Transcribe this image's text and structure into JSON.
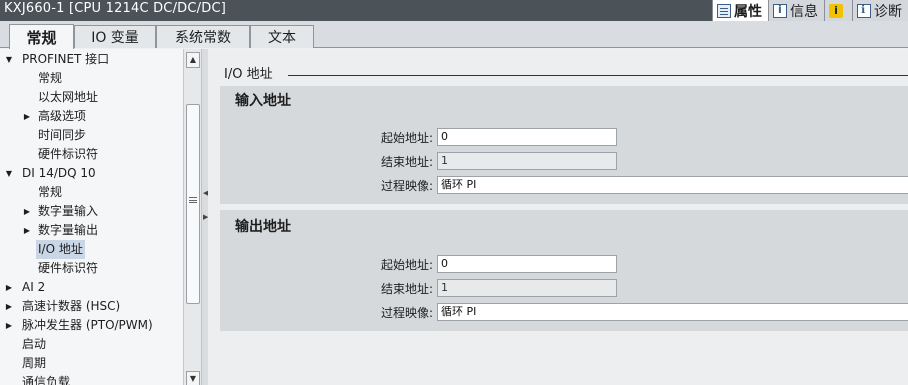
{
  "window": {
    "title": "KXJ660-1 [CPU 1214C DC/DC/DC]"
  },
  "inspector_tabs": [
    {
      "label": "属性",
      "icon": "properties-icon",
      "active": true
    },
    {
      "label": "信息",
      "icon": "info-icon",
      "active": false
    },
    {
      "label": "",
      "icon": "warning-icon",
      "active": false
    },
    {
      "label": "诊断",
      "icon": "diagnostics-icon",
      "active": false
    }
  ],
  "tabs": [
    {
      "label": "常规",
      "active": true
    },
    {
      "label": "IO 变量",
      "active": false
    },
    {
      "label": "系统常数",
      "active": false
    },
    {
      "label": "文本",
      "active": false
    }
  ],
  "tree": [
    {
      "label": "PROFINET 接口",
      "level": 0,
      "arrow": "expanded"
    },
    {
      "label": "常规",
      "level": 1,
      "arrow": "none"
    },
    {
      "label": "以太网地址",
      "level": 1,
      "arrow": "none"
    },
    {
      "label": "高级选项",
      "level": 1,
      "arrow": "collapsed"
    },
    {
      "label": "时间同步",
      "level": 1,
      "arrow": "none"
    },
    {
      "label": "硬件标识符",
      "level": 1,
      "arrow": "none"
    },
    {
      "label": "DI 14/DQ 10",
      "level": 0,
      "arrow": "expanded"
    },
    {
      "label": "常规",
      "level": 1,
      "arrow": "none"
    },
    {
      "label": "数字量输入",
      "level": 1,
      "arrow": "collapsed"
    },
    {
      "label": "数字量输出",
      "level": 1,
      "arrow": "collapsed"
    },
    {
      "label": "I/O 地址",
      "level": 1,
      "arrow": "none",
      "selected": true
    },
    {
      "label": "硬件标识符",
      "level": 1,
      "arrow": "none"
    },
    {
      "label": "AI 2",
      "level": 0,
      "arrow": "collapsed"
    },
    {
      "label": "高速计数器 (HSC)",
      "level": 0,
      "arrow": "collapsed"
    },
    {
      "label": "脉冲发生器 (PTO/PWM)",
      "level": 0,
      "arrow": "collapsed"
    },
    {
      "label": "启动",
      "level": 0,
      "arrow": "none"
    },
    {
      "label": "周期",
      "level": 0,
      "arrow": "none"
    },
    {
      "label": "通信负载",
      "level": 0,
      "arrow": "none"
    }
  ],
  "content": {
    "breadcrumb": "I/O 地址",
    "input": {
      "heading": "输入地址",
      "start_label": "起始地址:",
      "start_value": "0",
      "end_label": "结束地址:",
      "end_value": "1",
      "image_label": "过程映像:",
      "image_value": "循环 PI"
    },
    "output": {
      "heading": "输出地址",
      "start_label": "起始地址:",
      "start_value": "0",
      "end_label": "结束地址:",
      "end_value": "1",
      "image_label": "过程映像:",
      "image_value": "循环 PI"
    }
  }
}
